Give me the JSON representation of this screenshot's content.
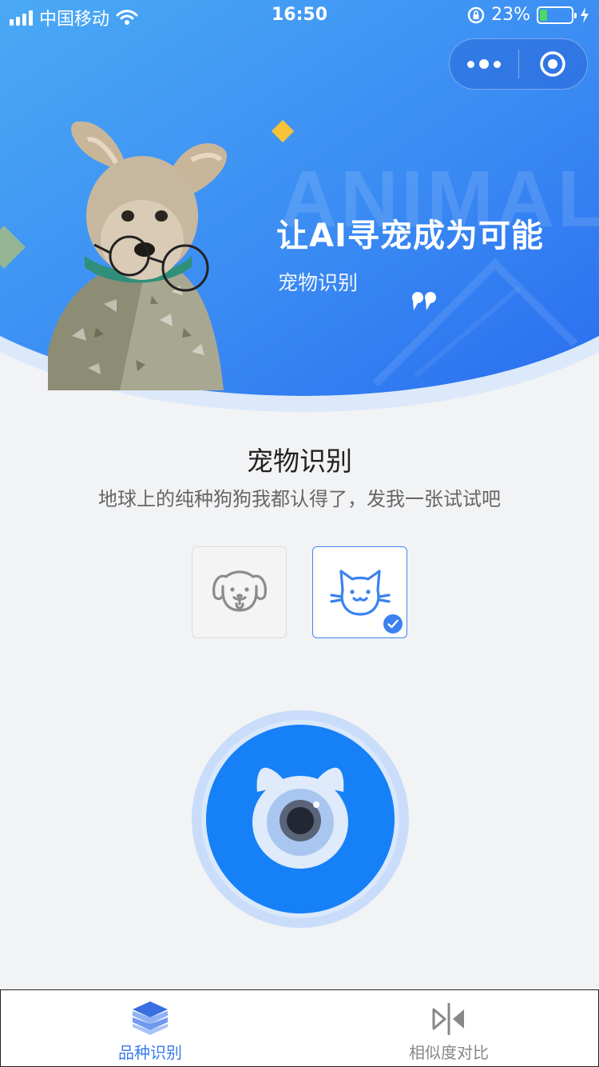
{
  "status_bar": {
    "carrier": "中国移动",
    "time": "16:50",
    "battery": "23%",
    "battery_level": 0.23
  },
  "hero": {
    "watermark": "ANIMAL",
    "title": "让AI寻宠成为可能",
    "subtitle": "宠物识别"
  },
  "main": {
    "title": "宠物识别",
    "description": "地球上的纯种狗狗我都认得了，发我一张试试吧",
    "pet_options": [
      {
        "icon": "dog-icon",
        "selected": false
      },
      {
        "icon": "cat-icon",
        "selected": true
      }
    ]
  },
  "tabbar": {
    "tabs": [
      {
        "label": "品种识别",
        "icon": "layers-icon",
        "active": true
      },
      {
        "label": "相似度对比",
        "icon": "compare-icon",
        "active": false
      }
    ]
  },
  "colors": {
    "primary": "#1a7cf5",
    "active_tab": "#3b7be8",
    "inactive_tab": "#888888"
  }
}
